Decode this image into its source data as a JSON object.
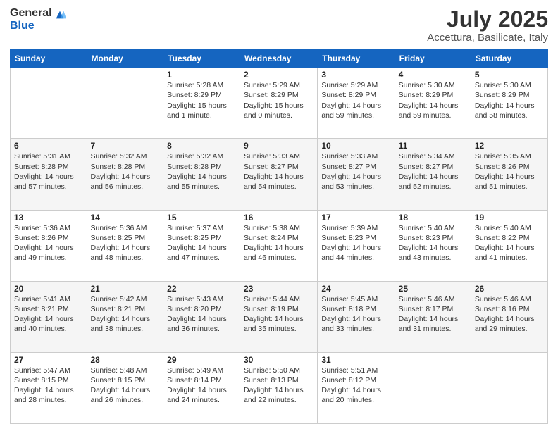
{
  "logo": {
    "general": "General",
    "blue": "Blue"
  },
  "title": {
    "month": "July 2025",
    "location": "Accettura, Basilicate, Italy"
  },
  "weekdays": [
    "Sunday",
    "Monday",
    "Tuesday",
    "Wednesday",
    "Thursday",
    "Friday",
    "Saturday"
  ],
  "weeks": [
    [
      {
        "day": "",
        "info": ""
      },
      {
        "day": "",
        "info": ""
      },
      {
        "day": "1",
        "info": "Sunrise: 5:28 AM\nSunset: 8:29 PM\nDaylight: 15 hours\nand 1 minute."
      },
      {
        "day": "2",
        "info": "Sunrise: 5:29 AM\nSunset: 8:29 PM\nDaylight: 15 hours\nand 0 minutes."
      },
      {
        "day": "3",
        "info": "Sunrise: 5:29 AM\nSunset: 8:29 PM\nDaylight: 14 hours\nand 59 minutes."
      },
      {
        "day": "4",
        "info": "Sunrise: 5:30 AM\nSunset: 8:29 PM\nDaylight: 14 hours\nand 59 minutes."
      },
      {
        "day": "5",
        "info": "Sunrise: 5:30 AM\nSunset: 8:29 PM\nDaylight: 14 hours\nand 58 minutes."
      }
    ],
    [
      {
        "day": "6",
        "info": "Sunrise: 5:31 AM\nSunset: 8:28 PM\nDaylight: 14 hours\nand 57 minutes."
      },
      {
        "day": "7",
        "info": "Sunrise: 5:32 AM\nSunset: 8:28 PM\nDaylight: 14 hours\nand 56 minutes."
      },
      {
        "day": "8",
        "info": "Sunrise: 5:32 AM\nSunset: 8:28 PM\nDaylight: 14 hours\nand 55 minutes."
      },
      {
        "day": "9",
        "info": "Sunrise: 5:33 AM\nSunset: 8:27 PM\nDaylight: 14 hours\nand 54 minutes."
      },
      {
        "day": "10",
        "info": "Sunrise: 5:33 AM\nSunset: 8:27 PM\nDaylight: 14 hours\nand 53 minutes."
      },
      {
        "day": "11",
        "info": "Sunrise: 5:34 AM\nSunset: 8:27 PM\nDaylight: 14 hours\nand 52 minutes."
      },
      {
        "day": "12",
        "info": "Sunrise: 5:35 AM\nSunset: 8:26 PM\nDaylight: 14 hours\nand 51 minutes."
      }
    ],
    [
      {
        "day": "13",
        "info": "Sunrise: 5:36 AM\nSunset: 8:26 PM\nDaylight: 14 hours\nand 49 minutes."
      },
      {
        "day": "14",
        "info": "Sunrise: 5:36 AM\nSunset: 8:25 PM\nDaylight: 14 hours\nand 48 minutes."
      },
      {
        "day": "15",
        "info": "Sunrise: 5:37 AM\nSunset: 8:25 PM\nDaylight: 14 hours\nand 47 minutes."
      },
      {
        "day": "16",
        "info": "Sunrise: 5:38 AM\nSunset: 8:24 PM\nDaylight: 14 hours\nand 46 minutes."
      },
      {
        "day": "17",
        "info": "Sunrise: 5:39 AM\nSunset: 8:23 PM\nDaylight: 14 hours\nand 44 minutes."
      },
      {
        "day": "18",
        "info": "Sunrise: 5:40 AM\nSunset: 8:23 PM\nDaylight: 14 hours\nand 43 minutes."
      },
      {
        "day": "19",
        "info": "Sunrise: 5:40 AM\nSunset: 8:22 PM\nDaylight: 14 hours\nand 41 minutes."
      }
    ],
    [
      {
        "day": "20",
        "info": "Sunrise: 5:41 AM\nSunset: 8:21 PM\nDaylight: 14 hours\nand 40 minutes."
      },
      {
        "day": "21",
        "info": "Sunrise: 5:42 AM\nSunset: 8:21 PM\nDaylight: 14 hours\nand 38 minutes."
      },
      {
        "day": "22",
        "info": "Sunrise: 5:43 AM\nSunset: 8:20 PM\nDaylight: 14 hours\nand 36 minutes."
      },
      {
        "day": "23",
        "info": "Sunrise: 5:44 AM\nSunset: 8:19 PM\nDaylight: 14 hours\nand 35 minutes."
      },
      {
        "day": "24",
        "info": "Sunrise: 5:45 AM\nSunset: 8:18 PM\nDaylight: 14 hours\nand 33 minutes."
      },
      {
        "day": "25",
        "info": "Sunrise: 5:46 AM\nSunset: 8:17 PM\nDaylight: 14 hours\nand 31 minutes."
      },
      {
        "day": "26",
        "info": "Sunrise: 5:46 AM\nSunset: 8:16 PM\nDaylight: 14 hours\nand 29 minutes."
      }
    ],
    [
      {
        "day": "27",
        "info": "Sunrise: 5:47 AM\nSunset: 8:15 PM\nDaylight: 14 hours\nand 28 minutes."
      },
      {
        "day": "28",
        "info": "Sunrise: 5:48 AM\nSunset: 8:15 PM\nDaylight: 14 hours\nand 26 minutes."
      },
      {
        "day": "29",
        "info": "Sunrise: 5:49 AM\nSunset: 8:14 PM\nDaylight: 14 hours\nand 24 minutes."
      },
      {
        "day": "30",
        "info": "Sunrise: 5:50 AM\nSunset: 8:13 PM\nDaylight: 14 hours\nand 22 minutes."
      },
      {
        "day": "31",
        "info": "Sunrise: 5:51 AM\nSunset: 8:12 PM\nDaylight: 14 hours\nand 20 minutes."
      },
      {
        "day": "",
        "info": ""
      },
      {
        "day": "",
        "info": ""
      }
    ]
  ]
}
